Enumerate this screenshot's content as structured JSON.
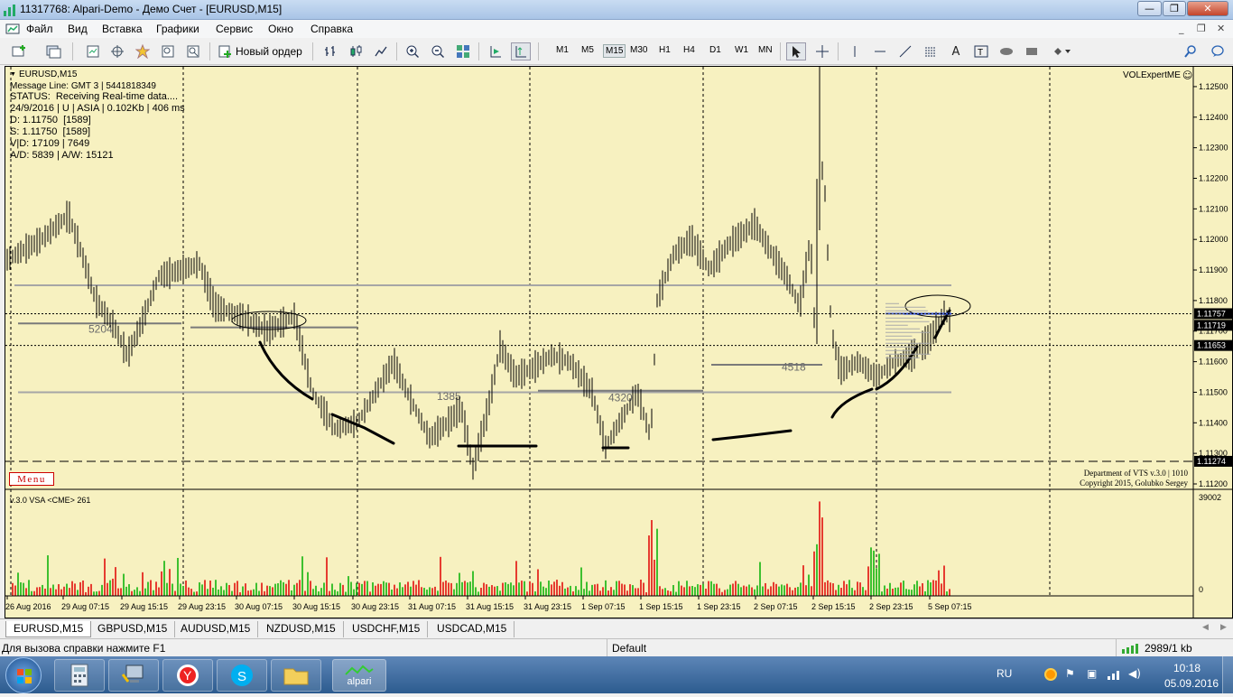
{
  "window": {
    "title": "11317768: Alpari-Demo - Демо Счет - [EURUSD,M15]",
    "controls": {
      "minimize": "—",
      "restore": "❐",
      "close": "✕"
    }
  },
  "menu": {
    "items": [
      "Файл",
      "Вид",
      "Вставка",
      "Графики",
      "Сервис",
      "Окно",
      "Справка"
    ]
  },
  "toolbar": {
    "new_order_label": "Новый ордер",
    "timeframes": [
      "M1",
      "M5",
      "M15",
      "M30",
      "H1",
      "H4",
      "D1",
      "W1",
      "MN"
    ],
    "active_timeframe": "M15"
  },
  "chart": {
    "symbol_label": "EURUSD,M15",
    "info_lines": [
      "Message Line: GMT 3 | 5441818349",
      "STATUS:  Receiving Real-time data....",
      "24/9/2016 | U | ASIA | 0.102Kb | 406 ms",
      "D: 1.11750  [1589]",
      "S: 1.11750  [1589]",
      "V|D: 17109 | 7649",
      "A/D: 5839 | A/W: 15121"
    ],
    "expert_label": "VOLExpertME",
    "menu_button": "Menu",
    "copyright_lines": [
      "Department of VTS  v.3.0 | 1010",
      "Copyright 2015, Golubko Sergey"
    ],
    "level_labels": [
      "5204",
      "4518",
      "4320",
      "1385"
    ],
    "price_ticks": [
      "1.12500",
      "1.12400",
      "1.12300",
      "1.12200",
      "1.12100",
      "1.12000",
      "1.11900",
      "1.11800",
      "1.11700",
      "1.11600",
      "1.11500",
      "1.11400",
      "1.11300",
      "1.11200"
    ],
    "price_markers": [
      "1.11757",
      "1.11719",
      "1.11653",
      "1.11274"
    ],
    "volume_panel_label": "v.3.0 VSA <CME> 261",
    "volume_max_label": "39002",
    "volume_min_label": "0",
    "time_ticks": [
      "26 Aug 2016",
      "29 Aug 07:15",
      "29 Aug 15:15",
      "29 Aug 23:15",
      "30 Aug 07:15",
      "30 Aug 15:15",
      "30 Aug 23:15",
      "31 Aug 07:15",
      "31 Aug 15:15",
      "31 Aug 23:15",
      "1 Sep 07:15",
      "1 Sep 15:15",
      "1 Sep 23:15",
      "2 Sep 07:15",
      "2 Sep 15:15",
      "2 Sep 23:15",
      "5 Sep 07:15"
    ],
    "colors": {
      "background": "#f7f1c0",
      "bars": "#000000",
      "level_line": "#a6a6a6",
      "volume_up": "#00b000",
      "volume_down": "#e00000",
      "marker_blue": "#3050e0"
    }
  },
  "tabs": [
    "EURUSD,M15",
    "GBPUSD,M15",
    "AUDUSD,M15",
    "NZDUSD,M15",
    "USDCHF,M15",
    "USDCAD,M15"
  ],
  "active_tab": "EURUSD,M15",
  "status": {
    "help": "Для вызова справки нажмите F1",
    "profile": "Default",
    "traffic": "2989/1 kb"
  },
  "taskbar": {
    "app_label": "alpari",
    "lang": "RU",
    "time": "10:18",
    "date": "05.09.2016"
  }
}
